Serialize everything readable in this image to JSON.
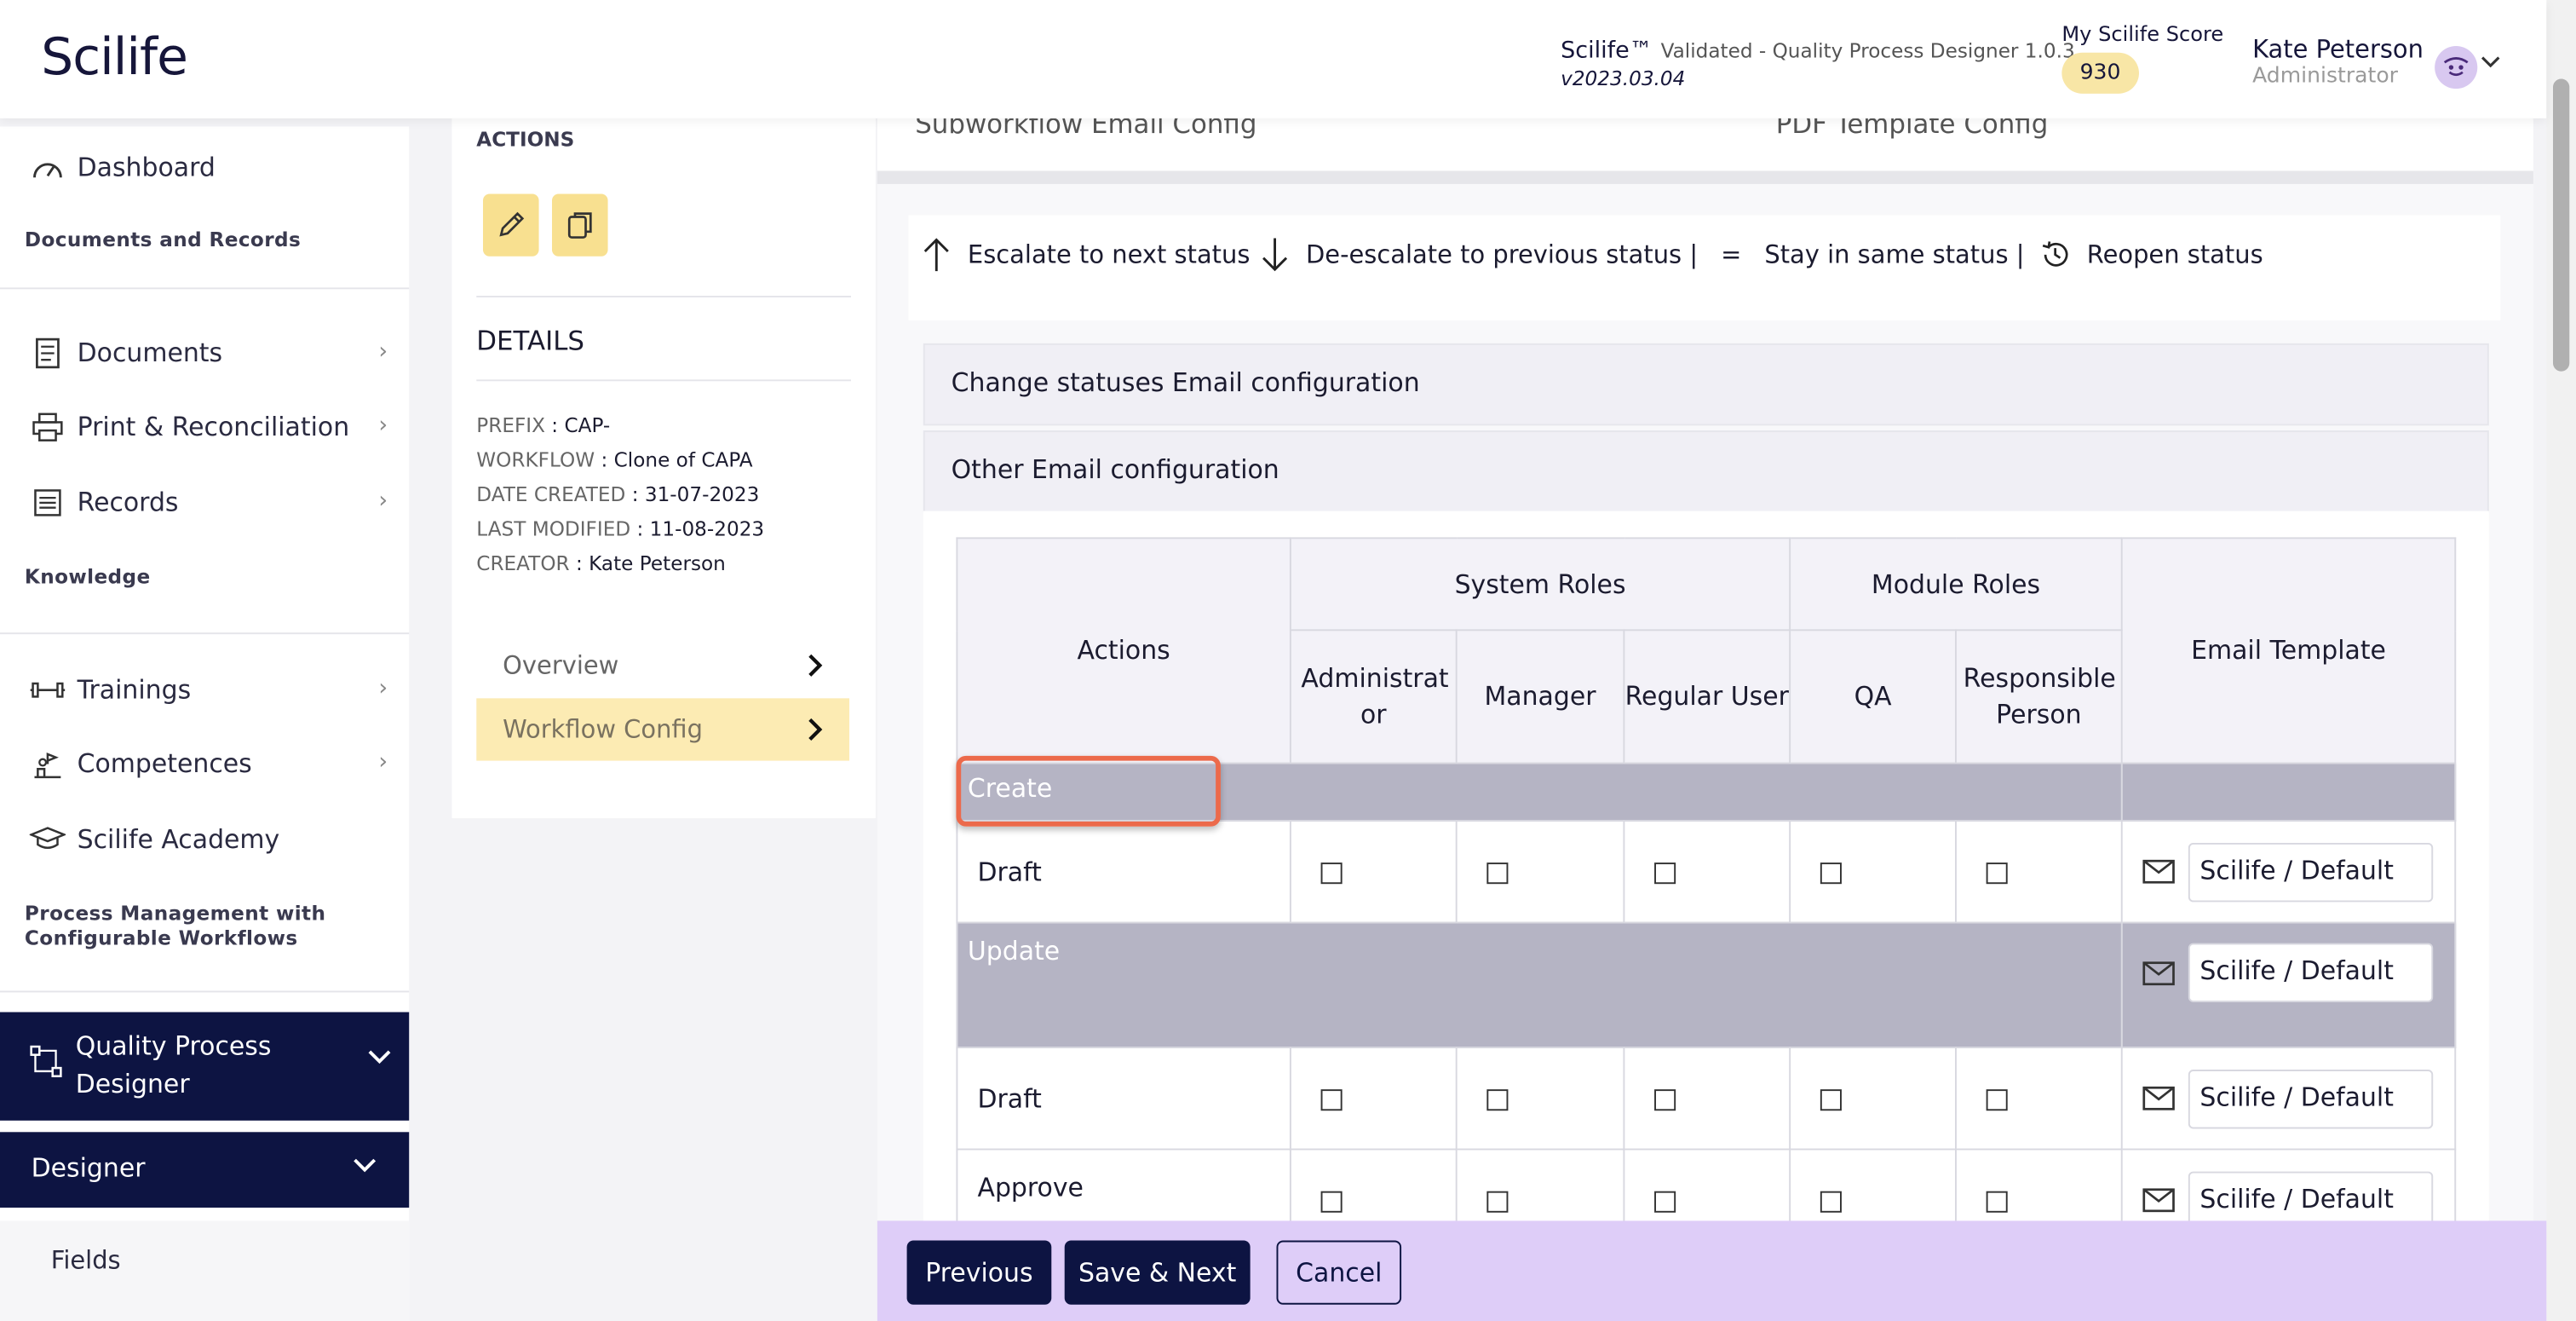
{
  "header": {
    "logo": "Scilife",
    "app_name": "Scilife™",
    "app_desc": "Validated - Quality Process Designer 1.0.3",
    "version": "v2023.03.04",
    "score_label": "My Scilife Score",
    "score_value": "930",
    "user_name": "Kate Peterson",
    "user_role": "Administrator"
  },
  "sidebar": {
    "dashboard": "Dashboard",
    "sec_docs": "Documents and Records",
    "documents": "Documents",
    "print": "Print & Reconciliation",
    "records": "Records",
    "sec_knowledge": "Knowledge",
    "trainings": "Trainings",
    "competences": "Competences",
    "academy": "Scilife Academy",
    "sec_process": "Process Management with Configurable Workflows",
    "qpd": "Quality Process Designer",
    "designer": "Designer",
    "fields": "Fields"
  },
  "details": {
    "actions_label": "ACTIONS",
    "title": "DETAILS",
    "prefix_k": "PREFIX",
    "prefix_v": "CAP-",
    "workflow_k": "WORKFLOW",
    "workflow_v": "Clone of CAPA",
    "created_k": "DATE CREATED",
    "created_v": "31-07-2023",
    "modified_k": "LAST MODIFIED",
    "modified_v": "11-08-2023",
    "creator_k": "CREATOR",
    "creator_v": "Kate Peterson",
    "nav_overview": "Overview",
    "nav_workflow": "Workflow Config"
  },
  "tabs": {
    "subworkflow": "Subworkflow Email Config",
    "pdf": "PDF Template Config"
  },
  "legend": {
    "escalate": "Escalate to next status",
    "deescalate": "De-escalate to previous status |",
    "stay_symbol": "=",
    "stay": "Stay in same status |",
    "reopen": "Reopen status"
  },
  "accordions": {
    "change_statuses": "Change statuses Email configuration",
    "other": "Other Email configuration"
  },
  "table": {
    "col_actions": "Actions",
    "col_system_roles": "System Roles",
    "col_module_roles": "Module Roles",
    "col_email_template": "Email Template",
    "col_admin": "Administrat or",
    "col_manager": "Manager",
    "col_regular": "Regular User",
    "col_qa": "QA",
    "col_responsible": "Responsible Person",
    "group_create": "Create",
    "group_update": "Update",
    "row_draft": "Draft",
    "row_approve": "Approve",
    "template_value": "Scilife / Default"
  },
  "footer": {
    "previous": "Previous",
    "save_next": "Save & Next",
    "cancel": "Cancel"
  }
}
